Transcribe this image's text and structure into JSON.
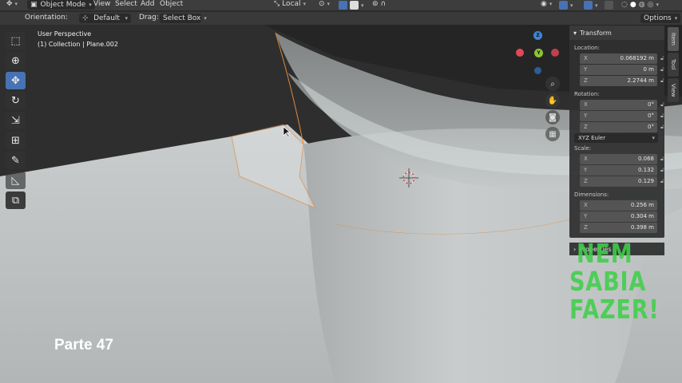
{
  "header": {
    "mode": "Object Mode",
    "menus": [
      "View",
      "Select",
      "Add",
      "Object"
    ],
    "transform_space": "Local"
  },
  "subheader": {
    "orientation_label": "Orientation:",
    "orientation_value": "Default",
    "drag_label": "Drag:",
    "drag_value": "Select Box",
    "options": "Options"
  },
  "viewport": {
    "perspective": "User Perspective",
    "collection": "(1) Collection | Plane.002"
  },
  "gizmo": {
    "x": "X",
    "y": "Y",
    "z": "Z"
  },
  "npanel": {
    "transform_title": "Transform",
    "location_label": "Location:",
    "location": [
      {
        "axis": "X",
        "value": "0.068192 m"
      },
      {
        "axis": "Y",
        "value": "0 m"
      },
      {
        "axis": "Z",
        "value": "2.2744 m"
      }
    ],
    "rotation_label": "Rotation:",
    "rotation": [
      {
        "axis": "X",
        "value": "0°"
      },
      {
        "axis": "Y",
        "value": "0°"
      },
      {
        "axis": "Z",
        "value": "0°"
      }
    ],
    "rotation_mode": "XYZ Euler",
    "scale_label": "Scale:",
    "scale": [
      {
        "axis": "X",
        "value": "0.068"
      },
      {
        "axis": "Y",
        "value": "0.132"
      },
      {
        "axis": "Z",
        "value": "0.129"
      }
    ],
    "dimensions_label": "Dimensions:",
    "dimensions": [
      {
        "axis": "X",
        "value": "0.256 m"
      },
      {
        "axis": "Y",
        "value": "0.304 m"
      },
      {
        "axis": "Z",
        "value": "0.398 m"
      }
    ],
    "properties_title": "Properties",
    "tabs": [
      "Item",
      "Tool",
      "View"
    ]
  },
  "overlay": {
    "line1": "NEM",
    "line2": "SABIA",
    "line3": "FAZER!",
    "parte": "Parte 47"
  },
  "colors": {
    "accent": "#4772b3",
    "axis_x": "#e5475a",
    "axis_y": "#8bc632",
    "axis_z": "#3d85d6",
    "overlay_text": "#3fd04a"
  }
}
